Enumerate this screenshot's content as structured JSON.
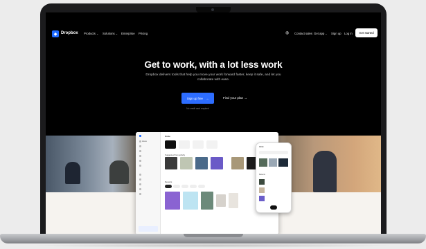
{
  "nav": {
    "brand": "Dropbox",
    "links": [
      "Products",
      "Solutions",
      "Enterprise",
      "Pricing"
    ],
    "right_links": [
      "Contact sales",
      "Get app",
      "Sign up",
      "Log in"
    ],
    "cta": "Get started"
  },
  "hero": {
    "title": "Get to work, with a lot less work",
    "subtitle": "Dropbox delivers tools that help you move your work forward faster, keep it safe, and let you collaborate with ease.",
    "primary_button": "Sign up free",
    "secondary_button": "Find your plan",
    "note": "No credit card required"
  },
  "app": {
    "home": "Home",
    "suggested": "Suggested from activity",
    "recents": "Recents"
  },
  "colors": {
    "accent": "#2d6dff",
    "background": "#000000"
  }
}
